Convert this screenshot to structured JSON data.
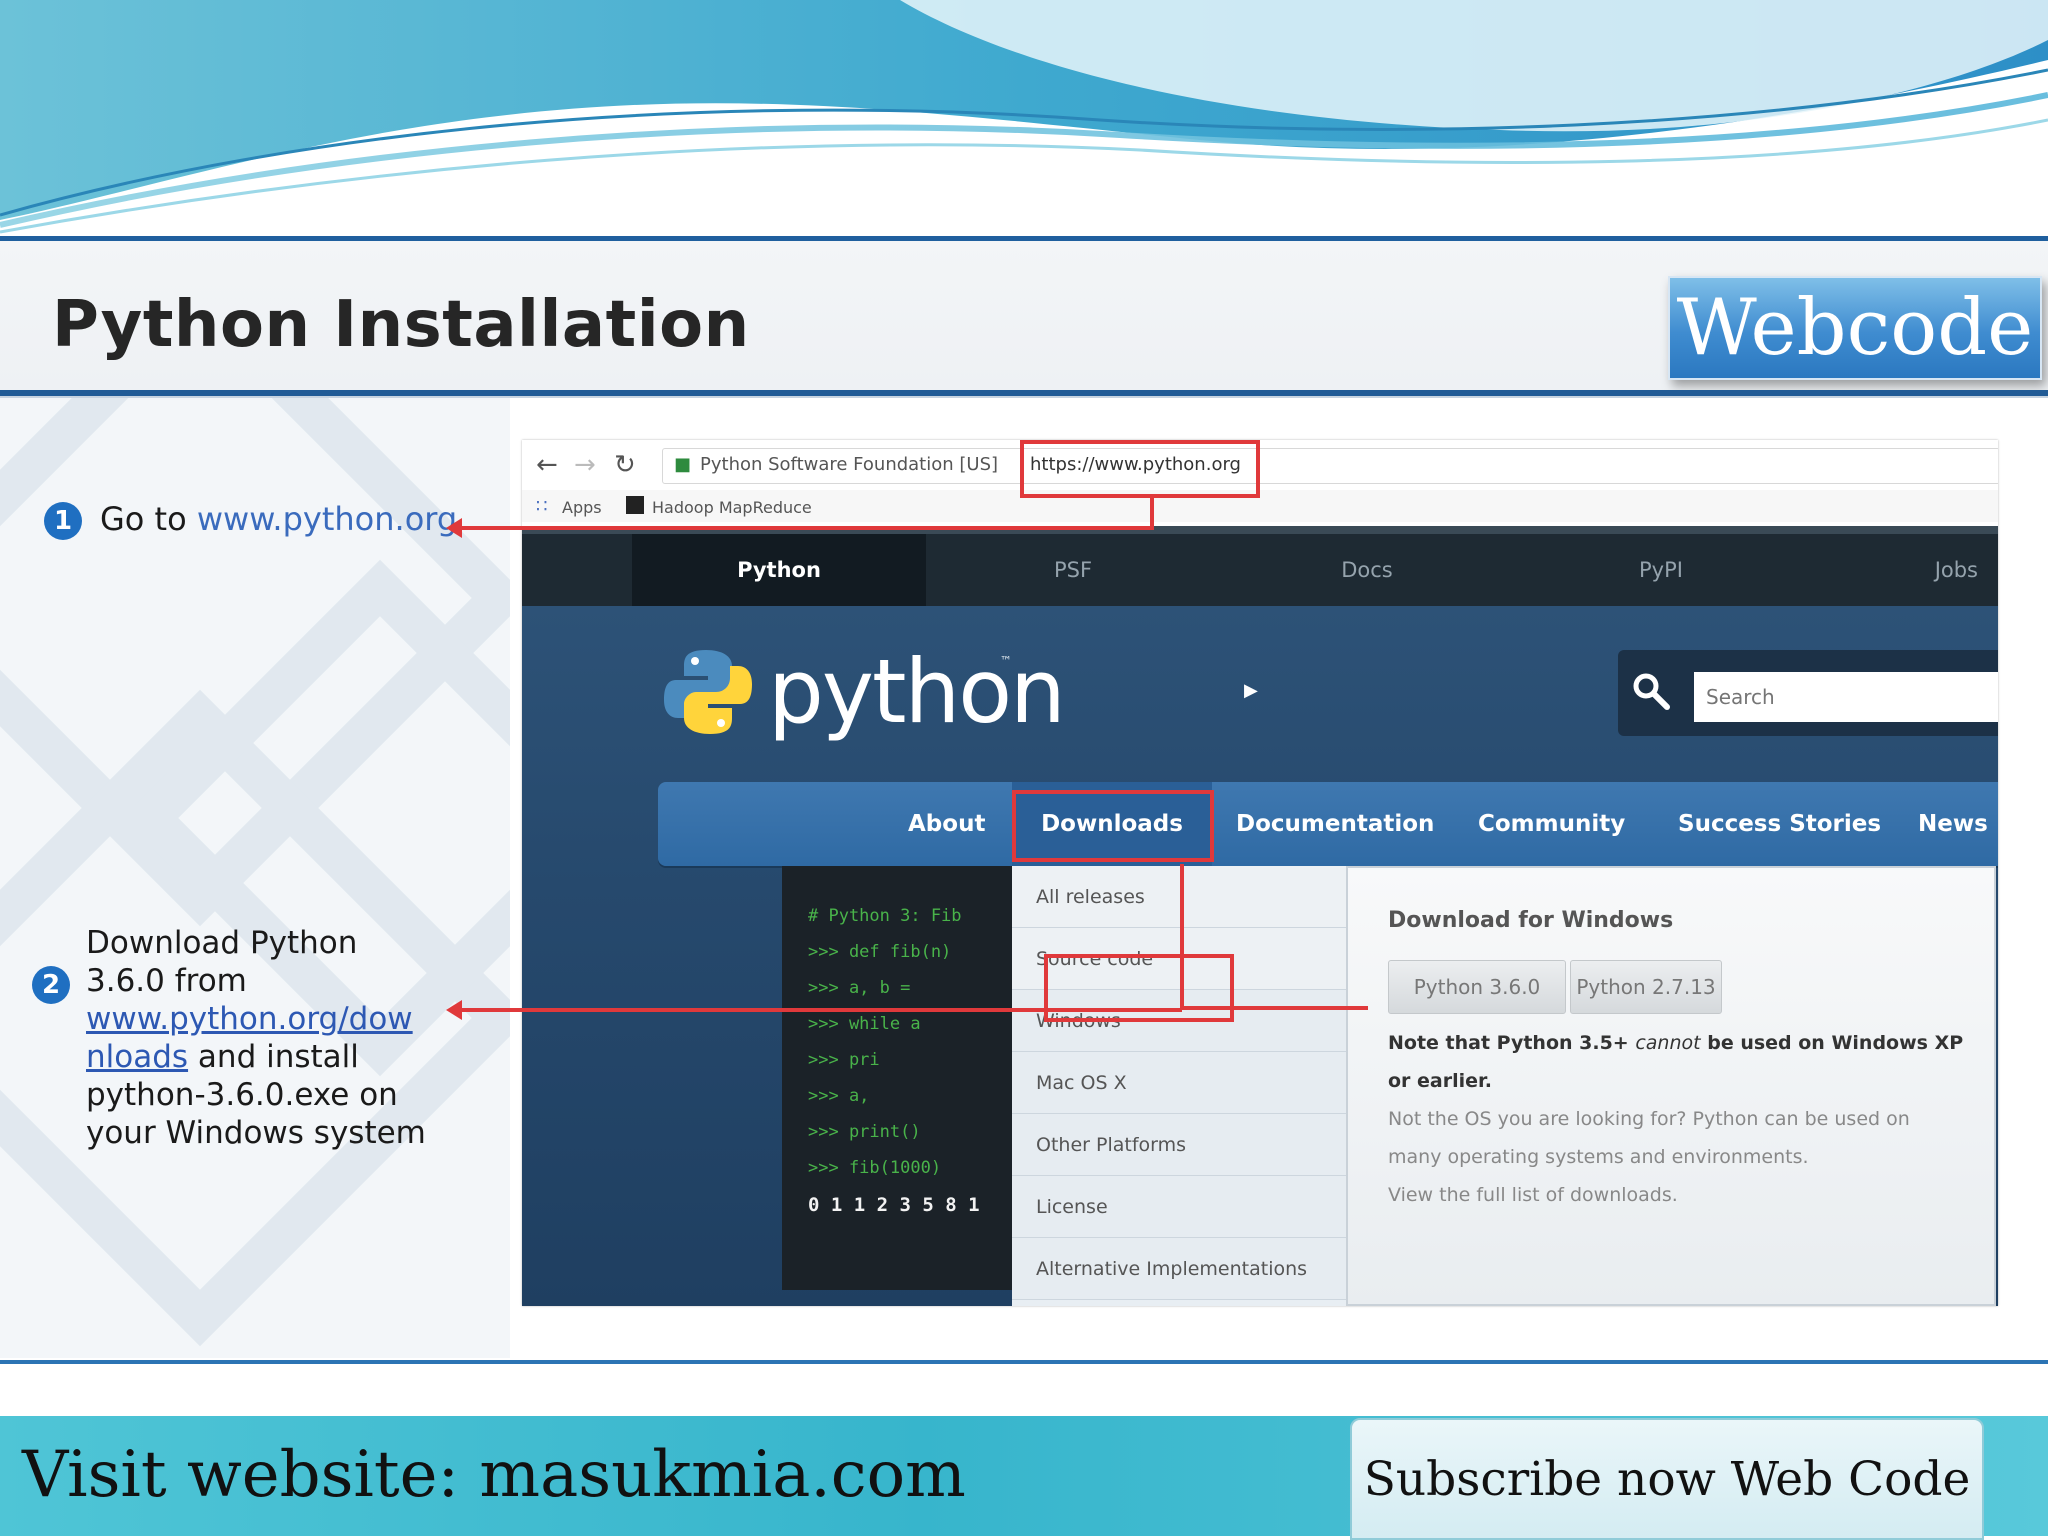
{
  "slide": {
    "title": "Python Installation",
    "badge": "Webcode",
    "step1": {
      "number": "1",
      "text": "Go to",
      "link": "www.python.org"
    },
    "step2": {
      "number": "2",
      "text_before": "Download Python 3.6.0 from",
      "link": "www.python.org/downloads",
      "text_after": "and install python-3.6.0.exe on your Windows system"
    }
  },
  "browser": {
    "back_glyph": "←",
    "forward_glyph": "→",
    "reload_glyph": "↻",
    "site_identity": "Python Software Foundation [US]",
    "url": "https://www.python.org",
    "bookmarks": [
      "Apps",
      "Hadoop MapReduce"
    ]
  },
  "python_site": {
    "top_nav": [
      "Python",
      "PSF",
      "Docs",
      "PyPI",
      "Jobs"
    ],
    "logo_text": "python",
    "logo_tm": "™",
    "search_placeholder": "Search",
    "main_nav": [
      "About",
      "Downloads",
      "Documentation",
      "Community",
      "Success Stories",
      "News"
    ],
    "code_lines": [
      "# Python 3: Fib",
      ">>> def fib(n)",
      ">>>     a, b =",
      ">>>     while a",
      ">>>         pri",
      ">>>         a,",
      ">>>     print()",
      ">>> fib(1000)",
      "0 1 1 2 3 5 8 1"
    ],
    "downloads_menu": [
      "All releases",
      "Source code",
      "Windows",
      "Mac OS X",
      "Other Platforms",
      "License",
      "Alternative Implementations"
    ],
    "download_panel": {
      "title": "Download for Windows",
      "buttons": [
        "Python 3.6.0",
        "Python 2.7.13"
      ],
      "note_bold_1": "Note that Python 3.5+",
      "note_em": "cannot",
      "note_bold_2": "be used on Windows XP",
      "note_bold_3": "or earlier.",
      "sub_1": "Not the OS you are looking for? Python can be used on",
      "sub_2": "many operating systems and environments.",
      "sub_3": "View the full list of downloads."
    }
  },
  "footer": {
    "visit": "Visit website: masukmia.com",
    "subscribe": "Subscribe now Web Code"
  },
  "colors": {
    "accent_blue": "#1f5f9e",
    "annotation_red": "#e0393b",
    "footer_teal": "#37b5cc"
  }
}
